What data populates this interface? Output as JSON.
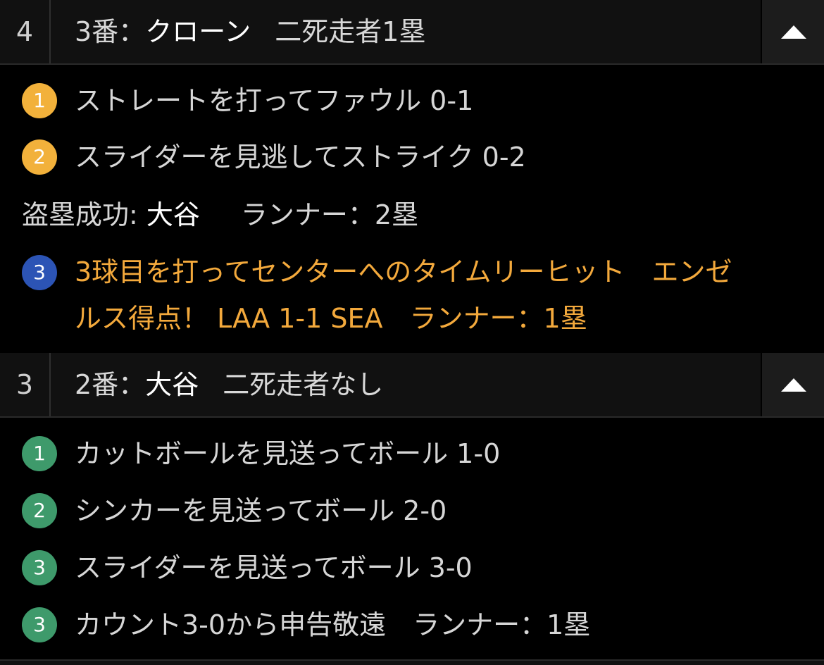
{
  "innings": [
    {
      "number": "4",
      "batter_order": "3番：",
      "batter_name": "クローン",
      "situation": "二死走者1塁",
      "events": [
        {
          "badge": "1",
          "text": "ストレートを打ってファウル 0-1"
        },
        {
          "badge": "2",
          "text": "スライダーを見逃してストライク 0-2"
        },
        {
          "note_label": "盗塁成功: ",
          "note_player": "大谷",
          "note_runner": "ランナー：2塁"
        },
        {
          "badge": "3",
          "line1": "3球目を打ってセンターへのタイムリーヒット　エンゼ",
          "line2": "ルス得点！ LAA 1-1 SEA　ランナー：1塁"
        }
      ]
    },
    {
      "number": "3",
      "batter_order": "2番：",
      "batter_name": "大谷",
      "situation": "二死走者なし",
      "events": [
        {
          "badge": "1",
          "text": "カットボールを見送ってボール 1-0"
        },
        {
          "badge": "2",
          "text": "シンカーを見送ってボール 2-0"
        },
        {
          "badge": "3",
          "text": "スライダーを見送ってボール 3-0"
        },
        {
          "badge": "3",
          "text": "カウント3-0から申告敬遠　ランナー：1塁"
        }
      ]
    }
  ],
  "icons": {
    "collapse": "triangle-up-icon"
  },
  "colors": {
    "background": "#000000",
    "header_bg": "#111111",
    "highlight": "#f3a93c",
    "badge_yellow": "#f2b13b",
    "badge_blue": "#2c54b5",
    "badge_green": "#3e9a6b"
  }
}
